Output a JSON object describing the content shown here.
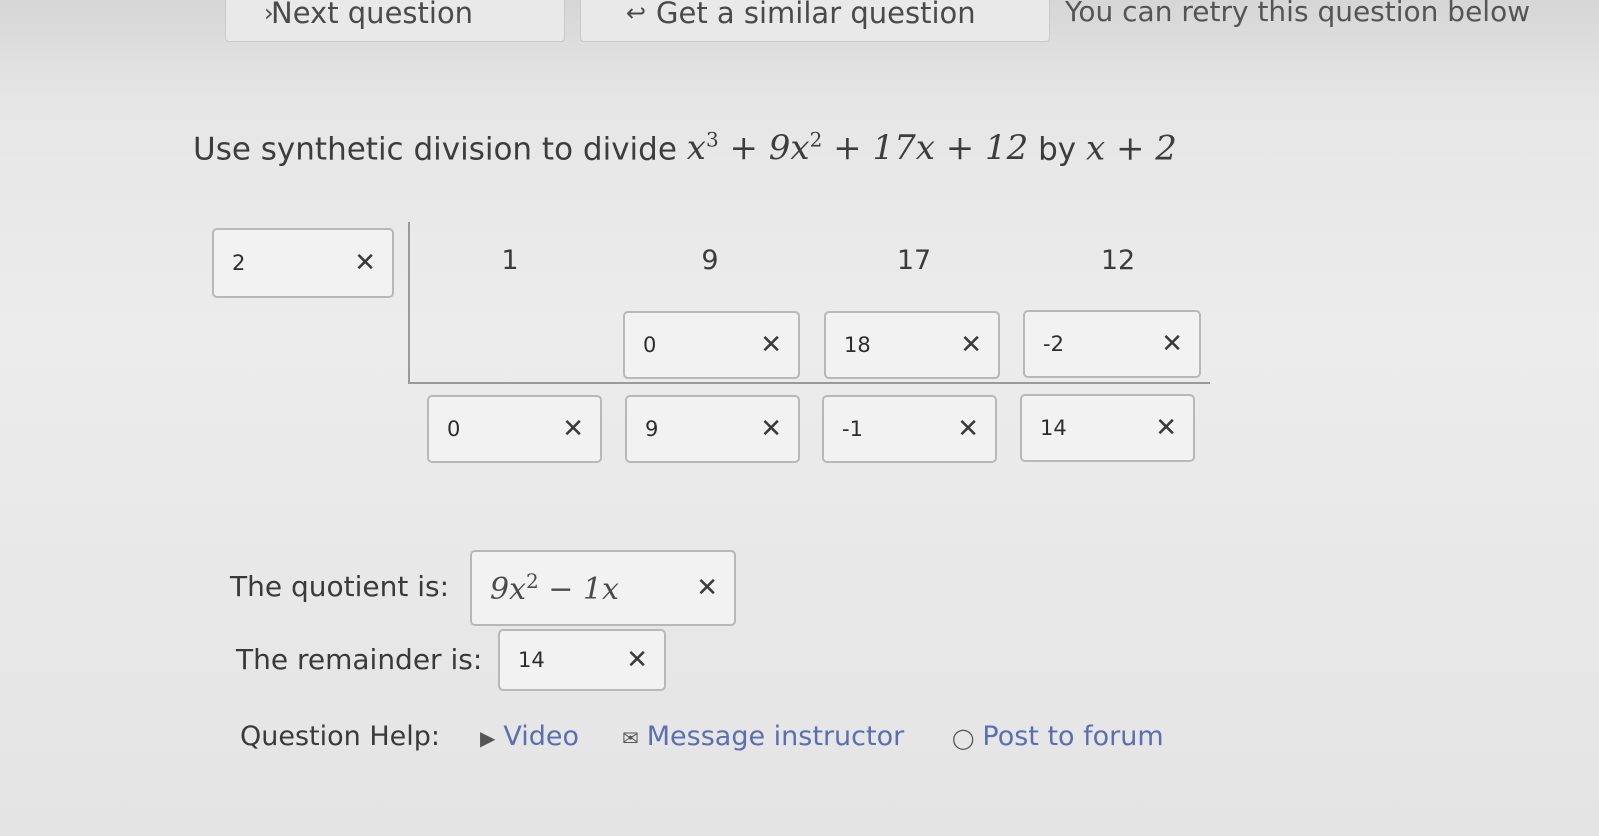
{
  "top": {
    "next_label": "Next question",
    "similar_label": "Get a similar question",
    "retry_note": "You can retry this question below"
  },
  "question": {
    "prefix": "Use synthetic division to divide",
    "by": "by"
  },
  "synthetic": {
    "divisor": "2",
    "coefficients": [
      "1",
      "9",
      "17",
      "12"
    ],
    "middle_row": [
      "0",
      "18",
      "-2"
    ],
    "bottom_row": [
      "0",
      "9",
      "-1",
      "14"
    ]
  },
  "answers": {
    "quotient_label": "The quotient is:",
    "remainder_label": "The remainder is:",
    "remainder_value": "14"
  },
  "help": {
    "label": "Question Help:",
    "video": "Video",
    "message": "Message instructor",
    "forum": "Post to forum"
  },
  "icons": {
    "next": "chevron-right-icon",
    "similar": "return-arrow-icon",
    "clear": "close-icon",
    "video": "video-icon",
    "message": "envelope-icon",
    "forum": "speech-bubble-icon"
  }
}
